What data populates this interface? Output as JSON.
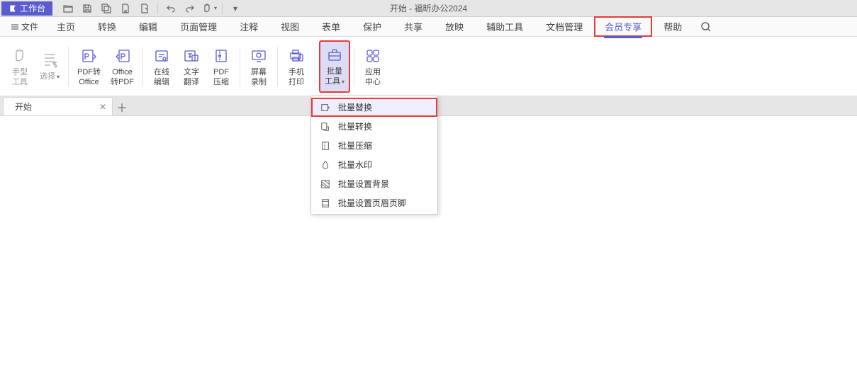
{
  "titlebar": {
    "workspace": "工作台",
    "title": "开始 - 福昕办公2024"
  },
  "menubar": {
    "file": "文件",
    "items": [
      "主页",
      "转换",
      "编辑",
      "页面管理",
      "注释",
      "视图",
      "表单",
      "保护",
      "共享",
      "放映",
      "辅助工具",
      "文档管理",
      "会员专享",
      "帮助"
    ],
    "active_index": 12
  },
  "ribbon": {
    "hand_tool": "手型\n工具",
    "select": "选择",
    "pdf_to_office": "PDF转\nOffice",
    "office_to_pdf": "Office\n转PDF",
    "online_edit": "在线\n编辑",
    "text_translate": "文字\n翻译",
    "pdf_compress": "PDF\n压缩",
    "screen_record": "屏幕\n录制",
    "phone_print": "手机\n打印",
    "batch_tools": "批量\n工具",
    "app_center": "应用\n中心"
  },
  "tabs": {
    "doc1": "开始"
  },
  "dropdown": {
    "batch_replace": "批量替换",
    "batch_convert": "批量转换",
    "batch_compress": "批量压缩",
    "batch_watermark": "批量水印",
    "batch_background": "批量设置背景",
    "batch_header_footer": "批量设置页眉页脚"
  }
}
